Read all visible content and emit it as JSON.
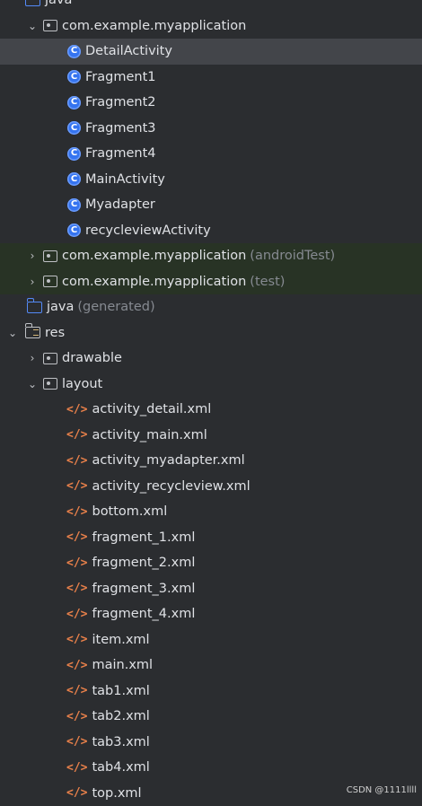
{
  "tree": {
    "java_label": "java",
    "package_main": "com.example.myapplication",
    "classes": [
      "DetailActivity",
      "Fragment1",
      "Fragment2",
      "Fragment3",
      "Fragment4",
      "MainActivity",
      "Myadapter",
      "recycleviewActivity"
    ],
    "package_androidtest": "com.example.myapplication",
    "package_androidtest_hint": "(androidTest)",
    "package_test": "com.example.myapplication",
    "package_test_hint": "(test)",
    "java_generated": "java",
    "java_generated_hint": "(generated)",
    "res_label": "res",
    "drawable_label": "drawable",
    "layout_label": "layout",
    "layout_files": [
      "activity_detail.xml",
      "activity_main.xml",
      "activity_myadapter.xml",
      "activity_recycleview.xml",
      "bottom.xml",
      "fragment_1.xml",
      "fragment_2.xml",
      "fragment_3.xml",
      "fragment_4.xml",
      "item.xml",
      "main.xml",
      "tab1.xml",
      "tab2.xml",
      "tab3.xml",
      "tab4.xml",
      "top.xml"
    ]
  },
  "icons": {
    "class_glyph": "C",
    "xml_glyph": "</>"
  },
  "watermark": "CSDN @1111llll"
}
